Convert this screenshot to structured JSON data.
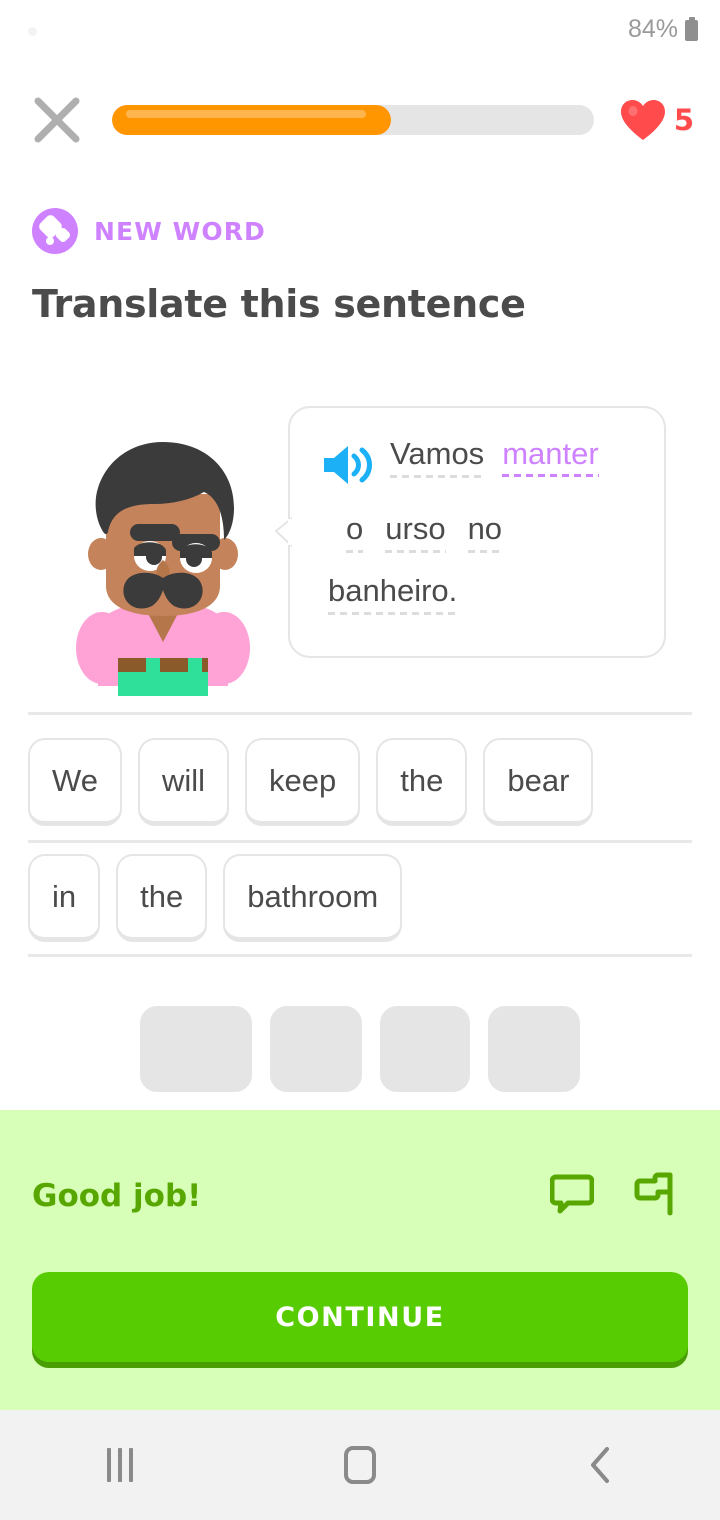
{
  "status_bar": {
    "battery_percent": "84%",
    "battery_icon": "battery-icon",
    "notification_dot": "notification-dot"
  },
  "header": {
    "close_icon": "close-icon",
    "progress_percent": 58,
    "progress_color": "#ff9600",
    "progress_track_color": "#e5e5e5",
    "hearts_icon": "heart-icon",
    "hearts_count": "5",
    "hearts_color": "#ff4b4b"
  },
  "challenge": {
    "badge_label": "NEW WORD",
    "badge_icon": "new-word-diamond-icon",
    "badge_color": "#ce82ff",
    "title": "Translate this sentence",
    "character_icon": "duolingo-character-vikram"
  },
  "prompt": {
    "speaker_icon": "speaker-icon",
    "speaker_color": "#1cb0f6",
    "line1": [
      {
        "text": "Vamos",
        "highlight": false
      },
      {
        "text": "manter",
        "highlight": true
      }
    ],
    "line2": [
      {
        "text": "o",
        "highlight": false
      },
      {
        "text": "urso",
        "highlight": false
      },
      {
        "text": "no",
        "highlight": false
      }
    ],
    "line3": [
      {
        "text": "banheiro.",
        "highlight": false
      }
    ],
    "full_sentence": "Vamos manter o urso no banheiro.",
    "highlight_color": "#ce82ff"
  },
  "answer": {
    "row1": [
      "We",
      "will",
      "keep",
      "the",
      "bear"
    ],
    "row2": [
      "in",
      "the",
      "bathroom"
    ],
    "full_answer": "We will keep the bear in the bathroom"
  },
  "word_bank": {
    "row1_slots": [
      4
    ],
    "row2_slots": [
      4
    ],
    "slot_widths_row1": [
      112,
      92,
      90,
      92
    ],
    "slot_widths_row2": [
      92,
      128,
      180,
      110
    ]
  },
  "feedback": {
    "message": "Good job!",
    "message_color": "#58a700",
    "panel_color": "#d7ffb8",
    "comment_icon": "comment-bubble-icon",
    "report_icon": "report-flag-icon",
    "continue_label": "CONTINUE",
    "continue_color": "#58cc02"
  },
  "navbar": {
    "recent_icon": "recent-apps-icon",
    "home_icon": "home-icon",
    "back_icon": "back-chevron-icon"
  }
}
